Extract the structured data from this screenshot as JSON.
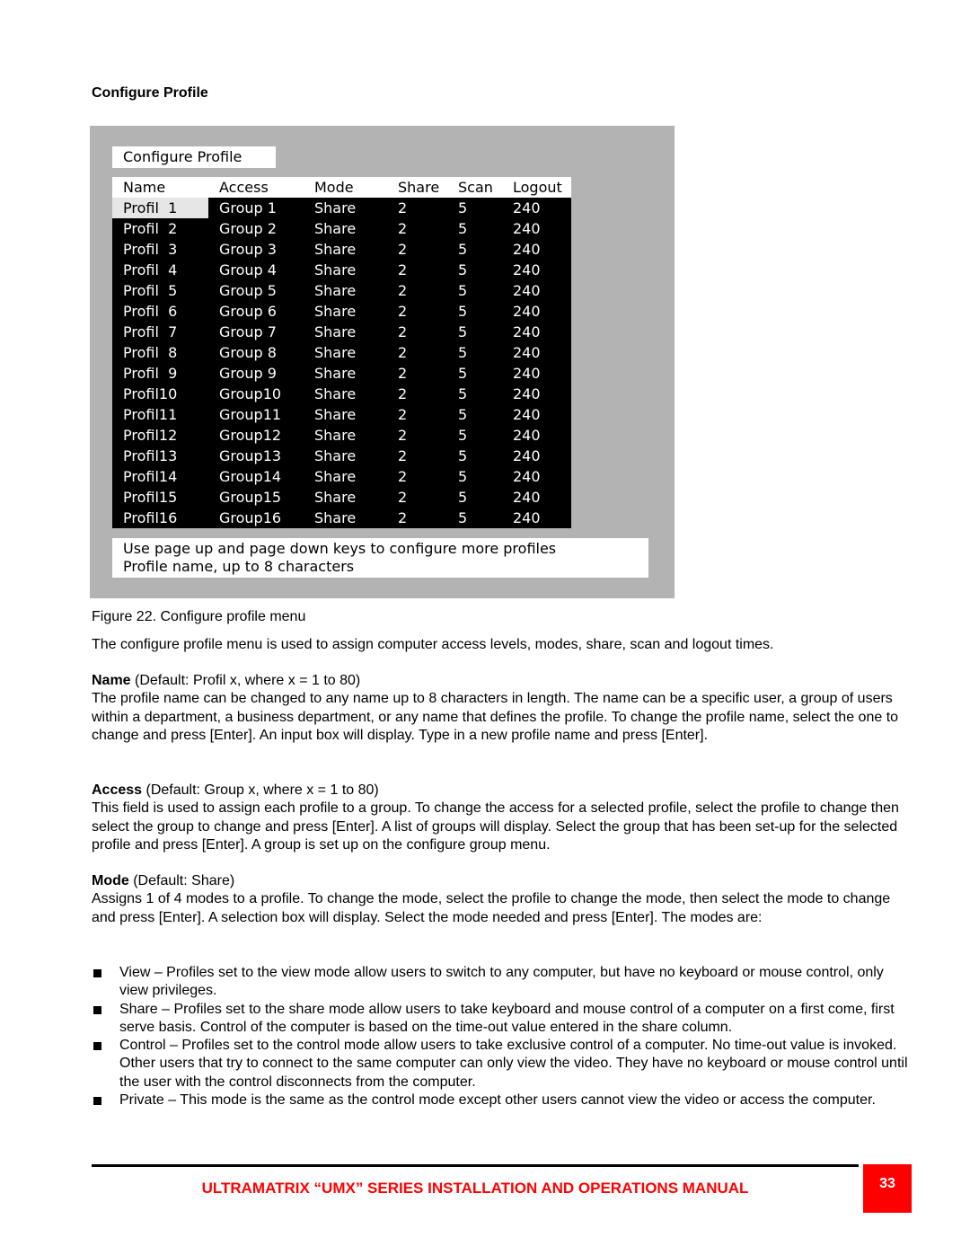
{
  "page": {
    "section_title": "Configure Profile",
    "page_number": "33",
    "footer_title": "ULTRAMATRIX “UMX” SERIES INSTALLATION AND OPERATIONS MANUAL"
  },
  "screen": {
    "title": "Configure Profile",
    "columns": [
      "Name",
      "Access",
      "Mode",
      "Share",
      "Scan",
      "Logout"
    ],
    "selected_cell": {
      "row": 0,
      "column": "Name"
    },
    "rows": [
      {
        "name": "Profil  1",
        "access": "Group 1",
        "mode": "Share",
        "share": "2",
        "scan": "5",
        "logout": "240"
      },
      {
        "name": "Profil  2",
        "access": "Group 2",
        "mode": "Share",
        "share": "2",
        "scan": "5",
        "logout": "240"
      },
      {
        "name": "Profil  3",
        "access": "Group 3",
        "mode": "Share",
        "share": "2",
        "scan": "5",
        "logout": "240"
      },
      {
        "name": "Profil  4",
        "access": "Group 4",
        "mode": "Share",
        "share": "2",
        "scan": "5",
        "logout": "240"
      },
      {
        "name": "Profil  5",
        "access": "Group 5",
        "mode": "Share",
        "share": "2",
        "scan": "5",
        "logout": "240"
      },
      {
        "name": "Profil  6",
        "access": "Group 6",
        "mode": "Share",
        "share": "2",
        "scan": "5",
        "logout": "240"
      },
      {
        "name": "Profil  7",
        "access": "Group 7",
        "mode": "Share",
        "share": "2",
        "scan": "5",
        "logout": "240"
      },
      {
        "name": "Profil  8",
        "access": "Group 8",
        "mode": "Share",
        "share": "2",
        "scan": "5",
        "logout": "240"
      },
      {
        "name": "Profil  9",
        "access": "Group 9",
        "mode": "Share",
        "share": "2",
        "scan": "5",
        "logout": "240"
      },
      {
        "name": "Profil10",
        "access": "Group10",
        "mode": "Share",
        "share": "2",
        "scan": "5",
        "logout": "240"
      },
      {
        "name": "Profil11",
        "access": "Group11",
        "mode": "Share",
        "share": "2",
        "scan": "5",
        "logout": "240"
      },
      {
        "name": "Profil12",
        "access": "Group12",
        "mode": "Share",
        "share": "2",
        "scan": "5",
        "logout": "240"
      },
      {
        "name": "Profil13",
        "access": "Group13",
        "mode": "Share",
        "share": "2",
        "scan": "5",
        "logout": "240"
      },
      {
        "name": "Profil14",
        "access": "Group14",
        "mode": "Share",
        "share": "2",
        "scan": "5",
        "logout": "240"
      },
      {
        "name": "Profil15",
        "access": "Group15",
        "mode": "Share",
        "share": "2",
        "scan": "5",
        "logout": "240"
      },
      {
        "name": "Profil16",
        "access": "Group16",
        "mode": "Share",
        "share": "2",
        "scan": "5",
        "logout": "240"
      }
    ],
    "help_lines": [
      "Use page up and page down keys to configure more profiles",
      "Profile name, up to 8 characters"
    ]
  },
  "text": {
    "caption": "Figure 22. Configure profile menu",
    "intro": "The configure profile menu is used to assign computer access levels, modes, share, scan and logout times.",
    "name": {
      "label": "Name",
      "default": " (Default: Profil x, where x = 1 to 80)",
      "body": "The profile name can be changed to any name up to 8 characters in length. The name can be a specific user, a group of users within a department, a business department, or any name that defines the profile.  To change the profile name, select the one to change and press [Enter].  An input box will display. Type in a new profile name and press [Enter]."
    },
    "access": {
      "label": "Access",
      "default": " (Default: Group x, where x = 1 to 80)",
      "body": "This field is used to assign each profile to a group. To change the access for a selected profile, select the profile to change then select the group to change and press [Enter].  A list of groups will display.  Select the group that has been set-up for the selected profile and press [Enter].  A group is set up on the configure group menu."
    },
    "mode": {
      "label": "Mode",
      "default": " (Default: Share)",
      "body": "Assigns 1 of 4 modes to a profile. To change the mode, select the profile to change the mode, then select the mode to change and press [Enter].  A selection box will display.  Select the mode needed and press [Enter].  The modes are:"
    },
    "modes": [
      "View – Profiles set to the view mode allow users to switch to any computer, but have no keyboard or mouse control, only view privileges.",
      "Share – Profiles set to the share mode allow users to take keyboard and mouse control of a computer on a first come, first serve basis. Control of the computer is based on the time-out value entered in the share column.",
      "Control – Profiles set to the control mode allow users to take exclusive control of a computer. No time-out value is invoked.  Other users that try to connect to the same computer can only view the video.  They have no keyboard or mouse control until the user with the control disconnects from the computer.",
      "Private – This mode is the same as the control mode except other users cannot view the video or access the computer."
    ]
  }
}
